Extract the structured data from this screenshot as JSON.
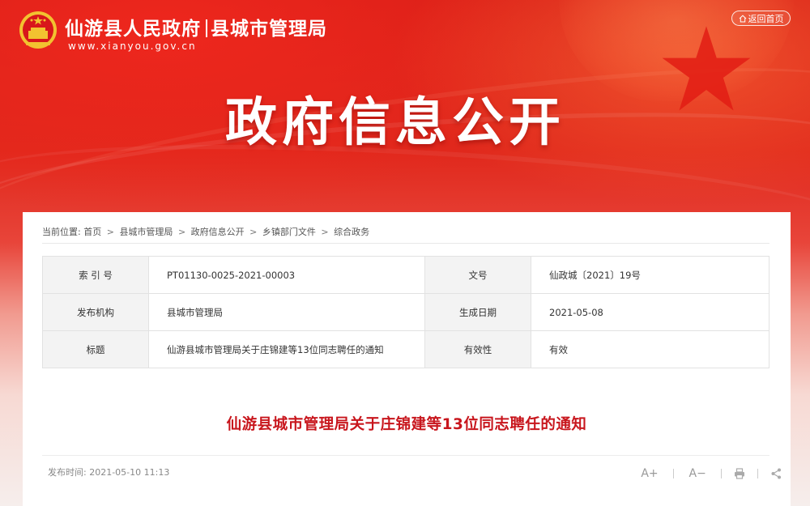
{
  "header": {
    "org_name": "仙游县人民政府",
    "dept_name": "县城市管理局",
    "url": "www.xianyou.gov.cn",
    "back_home_label": "返回首页",
    "banner_title": "政府信息公开"
  },
  "breadcrumb": {
    "prefix": "当前位置:",
    "items": [
      "首页",
      "县城市管理局",
      "政府信息公开",
      "乡镇部门文件",
      "综合政务"
    ],
    "separator": ">"
  },
  "meta_table": {
    "rows": [
      {
        "k1": "索 引 号",
        "v1": "PT01130-0025-2021-00003",
        "k2": "文号",
        "v2": "仙政城〔2021〕19号"
      },
      {
        "k1": "发布机构",
        "v1": "县城市管理局",
        "k2": "生成日期",
        "v2": "2021-05-08"
      },
      {
        "k1": "标题",
        "v1": "仙游县城市管理局关于庄锦建等13位同志聘任的通知",
        "k2": "有效性",
        "v2": "有效"
      }
    ]
  },
  "article": {
    "title": "仙游县城市管理局关于庄锦建等13位同志聘任的通知",
    "publish_time": "发布时间:  2021-05-10 11:13"
  },
  "tools": {
    "font_increase": "A+",
    "font_decrease": "A−"
  },
  "colors": {
    "brand_red": "#d81e17",
    "title_red": "#c8161d"
  }
}
